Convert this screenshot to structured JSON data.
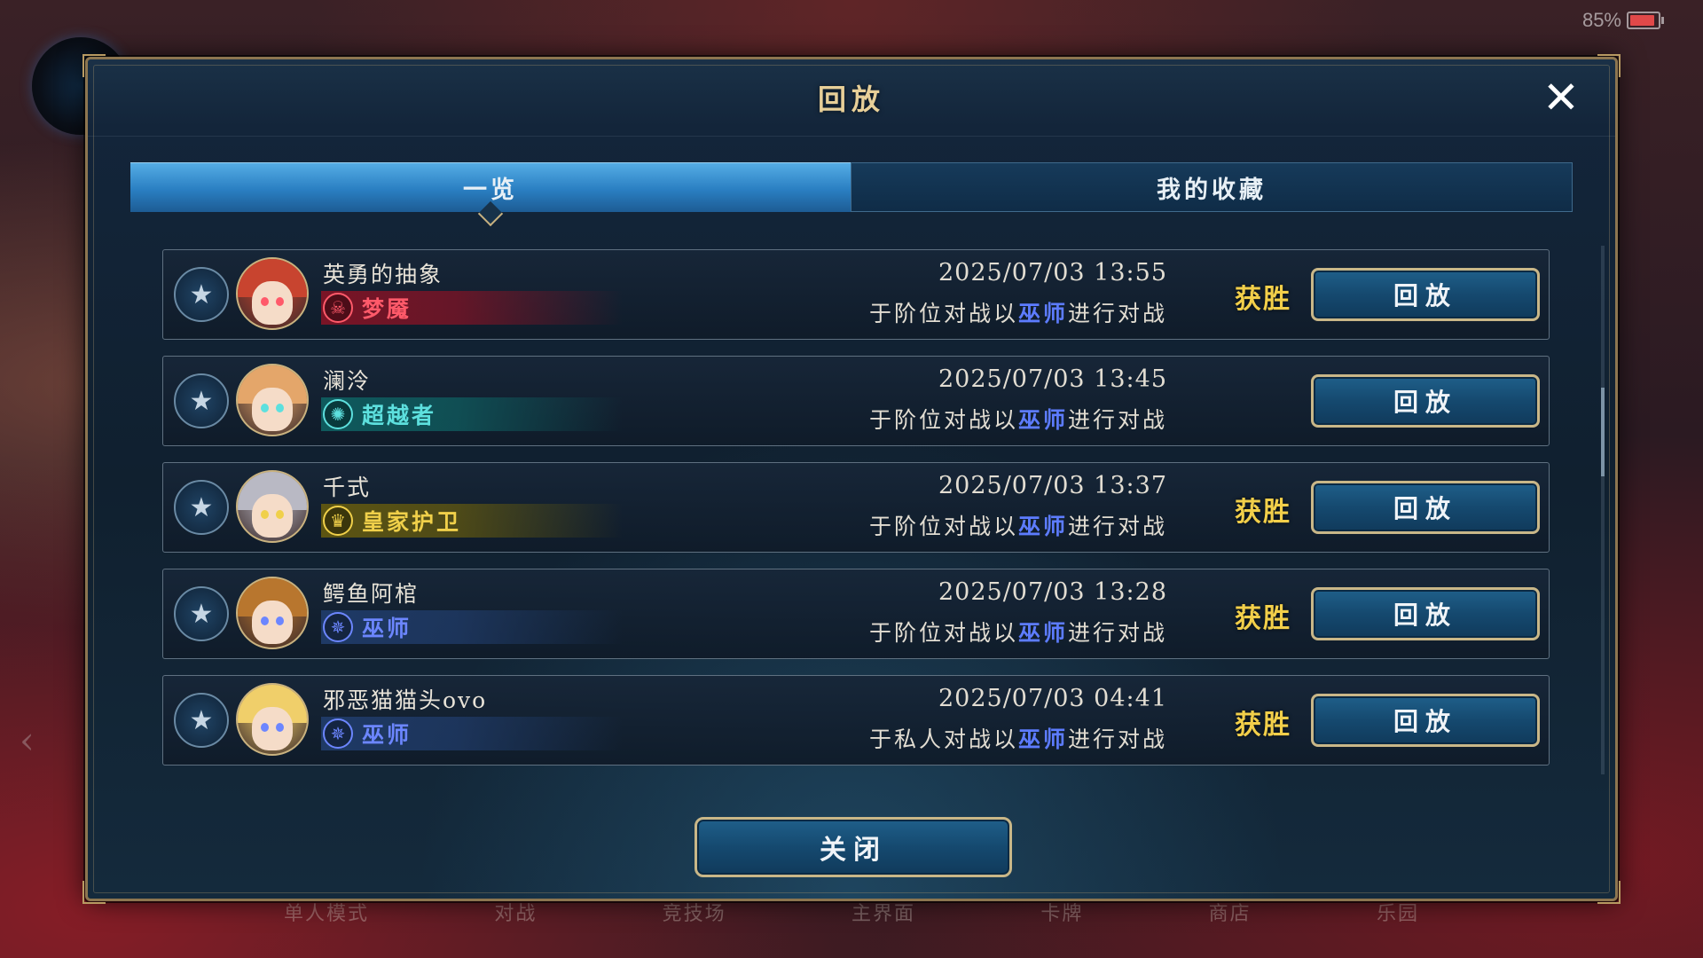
{
  "status": {
    "battery": "85%"
  },
  "background_nav": [
    "单人模式",
    "对战",
    "竞技场",
    "主界面",
    "卡牌",
    "商店",
    "乐园"
  ],
  "modal": {
    "title": "回放",
    "close_icon": "close-icon",
    "tabs": [
      {
        "label": "一览",
        "active": true
      },
      {
        "label": "我的收藏",
        "active": false
      }
    ],
    "close_button": "关闭"
  },
  "replays": [
    {
      "name": "英勇的抽象",
      "class_name": "梦魇",
      "class_icon": "nightmare-icon",
      "class_color": "#ff5a6a",
      "class_bg": "#7a1426",
      "datetime": "2025/07/03  13:55",
      "desc_prefix": "于阶位对战以",
      "desc_class": "巫师",
      "desc_suffix": "进行对战",
      "result": "获胜",
      "replay": "回放",
      "hair": "#c8442f"
    },
    {
      "name": "澜泠",
      "class_name": "超越者",
      "class_icon": "transcendent-icon",
      "class_color": "#5de0de",
      "class_bg": "#0f5a5d",
      "datetime": "2025/07/03  13:45",
      "desc_prefix": "于阶位对战以",
      "desc_class": "巫师",
      "desc_suffix": "进行对战",
      "result": "",
      "replay": "回放",
      "hair": "#e4a66a"
    },
    {
      "name": "千式",
      "class_name": "皇家护卫",
      "class_icon": "crown-icon",
      "class_color": "#f0d04a",
      "class_bg": "#5d5512",
      "datetime": "2025/07/03  13:37",
      "desc_prefix": "于阶位对战以",
      "desc_class": "巫师",
      "desc_suffix": "进行对战",
      "result": "获胜",
      "replay": "回放",
      "hair": "#b9b9c4"
    },
    {
      "name": "鳄鱼阿棺",
      "class_name": "巫师",
      "class_icon": "runecraft-icon",
      "class_color": "#6c86ff",
      "class_bg": "#1f3a66",
      "datetime": "2025/07/03  13:28",
      "desc_prefix": "于阶位对战以",
      "desc_class": "巫师",
      "desc_suffix": "进行对战",
      "result": "获胜",
      "replay": "回放",
      "hair": "#b8762e"
    },
    {
      "name": "邪恶猫猫头ovo",
      "class_name": "巫师",
      "class_icon": "runecraft-icon",
      "class_color": "#6c86ff",
      "class_bg": "#1f3a66",
      "datetime": "2025/07/03  04:41",
      "desc_prefix": "于私人对战以",
      "desc_class": "巫师",
      "desc_suffix": "进行对战",
      "result": "获胜",
      "replay": "回放",
      "hair": "#f0cf6a"
    }
  ]
}
